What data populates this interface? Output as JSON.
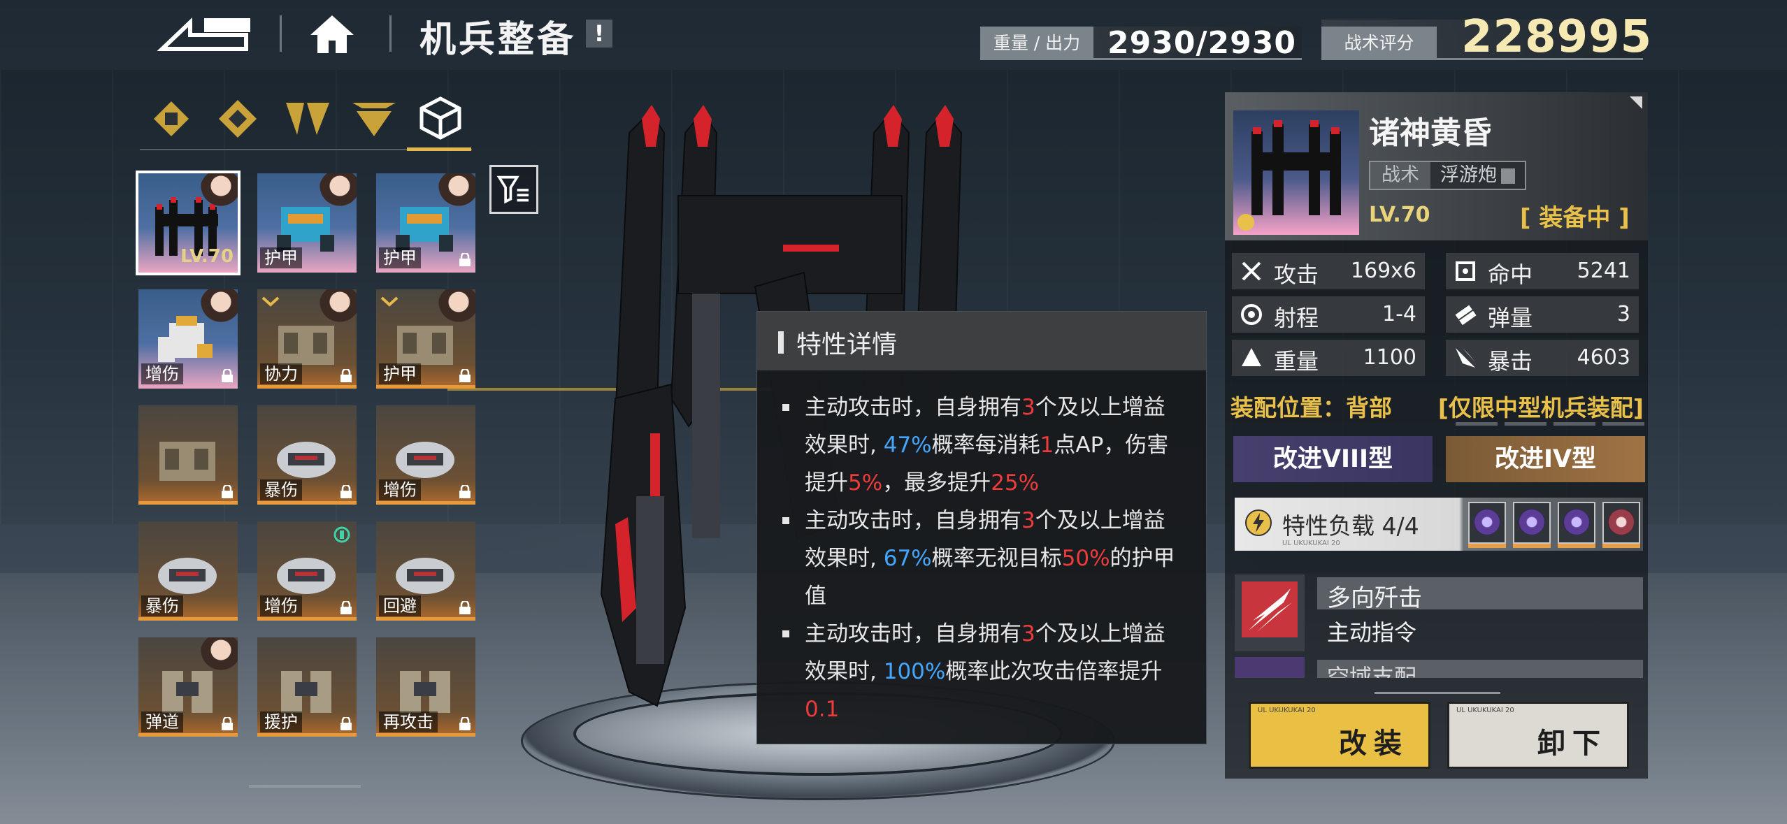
{
  "header": {
    "title": "机兵整备",
    "info_badge": "!",
    "weight_label": "重量 / 出力",
    "weight_value": "2930/2930",
    "score_label": "战术评分",
    "score_value": "228995"
  },
  "inventory": {
    "slots": [
      {
        "tag": "",
        "level": "LV.70",
        "selected": true,
        "locked": false,
        "style": "blue"
      },
      {
        "tag": "护甲",
        "selected": false,
        "locked": false,
        "style": "blue"
      },
      {
        "tag": "护甲",
        "selected": false,
        "locked": true,
        "style": "blue"
      },
      {
        "tag": "增伤",
        "selected": false,
        "locked": true,
        "style": "blue"
      },
      {
        "tag": "协力",
        "selected": false,
        "locked": true,
        "style": "orange"
      },
      {
        "tag": "护甲",
        "selected": false,
        "locked": true,
        "style": "orange"
      },
      {
        "tag": "",
        "selected": false,
        "locked": true,
        "style": "orange"
      },
      {
        "tag": "暴伤",
        "selected": false,
        "locked": true,
        "style": "orange"
      },
      {
        "tag": "增伤",
        "selected": false,
        "locked": true,
        "style": "orange"
      },
      {
        "tag": "暴伤",
        "selected": false,
        "locked": true,
        "style": "orange"
      },
      {
        "tag": "增伤",
        "selected": false,
        "locked": true,
        "style": "orange"
      },
      {
        "tag": "回避",
        "selected": false,
        "locked": true,
        "style": "orange"
      },
      {
        "tag": "弹道",
        "selected": false,
        "locked": true,
        "style": "orange"
      },
      {
        "tag": "援护",
        "selected": false,
        "locked": true,
        "style": "orange"
      },
      {
        "tag": "再攻击",
        "selected": false,
        "locked": true,
        "style": "orange"
      }
    ]
  },
  "trait_popup": {
    "title": "特性详情",
    "entries": [
      {
        "lines": [
          [
            [
              "主动攻击时，自身拥有",
              ""
            ],
            [
              "3",
              "red"
            ],
            [
              "个及以上增益",
              ""
            ]
          ],
          [
            [
              "效果时, ",
              ""
            ],
            [
              "47%",
              "blue"
            ],
            [
              "概率每消耗",
              ""
            ],
            [
              "1",
              "red"
            ],
            [
              "点AP，伤害",
              ""
            ]
          ],
          [
            [
              "提升",
              ""
            ],
            [
              "5%",
              "red"
            ],
            [
              "，最多提升",
              ""
            ],
            [
              "25%",
              "red"
            ]
          ]
        ]
      },
      {
        "lines": [
          [
            [
              "主动攻击时，自身拥有",
              ""
            ],
            [
              "3",
              "red"
            ],
            [
              "个及以上增益",
              ""
            ]
          ],
          [
            [
              "效果时, ",
              ""
            ],
            [
              "67%",
              "blue"
            ],
            [
              "概率无视目标",
              ""
            ],
            [
              "50%",
              "red"
            ],
            [
              "的护甲",
              ""
            ]
          ],
          [
            [
              "值",
              ""
            ]
          ]
        ]
      },
      {
        "lines": [
          [
            [
              "主动攻击时，自身拥有",
              ""
            ],
            [
              "3",
              "red"
            ],
            [
              "个及以上增益",
              ""
            ]
          ],
          [
            [
              "效果时, ",
              ""
            ],
            [
              "100%",
              "blue"
            ],
            [
              "概率此次攻击倍率提升",
              ""
            ]
          ],
          [
            [
              "0.1",
              "red"
            ]
          ]
        ]
      }
    ]
  },
  "equipment": {
    "name": "诸神黄昏",
    "tag_category": "战术",
    "tag_type": "浮游炮",
    "level": "LV.70",
    "status": "[ 装备中 ]",
    "stats": [
      {
        "label": "攻击",
        "value": "169x6",
        "icon": "sword-cross-icon"
      },
      {
        "label": "命中",
        "value": "5241",
        "icon": "target-icon"
      },
      {
        "label": "射程",
        "value": "1-4",
        "icon": "range-icon"
      },
      {
        "label": "弹量",
        "value": "3",
        "icon": "ammo-icon"
      },
      {
        "label": "重量",
        "value": "1100",
        "icon": "weight-icon"
      },
      {
        "label": "暴击",
        "value": "4603",
        "icon": "crit-icon"
      }
    ],
    "slot_position": "装配位置：背部",
    "slot_restriction": "[仅限中型机兵装配]",
    "upgrade_a": "改进VIII型",
    "upgrade_b": "改进IV型",
    "trait_load_label": "特性负载 4/4",
    "trait_load_sub": "UL UKUKUKAI 20",
    "skills": [
      {
        "name": "多向歼击",
        "type": "主动指令"
      },
      {
        "name": "空域支配",
        "type": ""
      }
    ],
    "refit_label": "改装",
    "unload_label": "卸下",
    "refit_tiny": "UL UKUKUKAI 20",
    "unload_tiny": "UL UKUKUKAI 20"
  },
  "colors": {
    "accent_gold": "#e9c14a",
    "highlight_red": "#ef3b3b",
    "highlight_blue": "#45a6ff"
  }
}
